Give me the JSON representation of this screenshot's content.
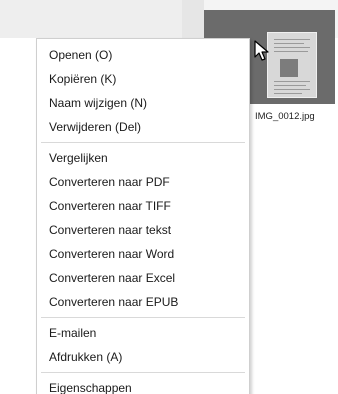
{
  "context_menu": {
    "groups": [
      [
        "Openen (O)",
        "Kopiëren (K)",
        "Naam wijzigen (N)",
        "Verwijderen (Del)"
      ],
      [
        "Vergelijken",
        "Converteren naar PDF",
        "Converteren naar TIFF",
        "Converteren naar tekst",
        "Converteren naar Word",
        "Converteren naar Excel",
        "Converteren naar EPUB"
      ],
      [
        "E-mailen",
        "Afdrukken (A)"
      ],
      [
        "Eigenschappen"
      ]
    ]
  },
  "thumbnail": {
    "filename": "IMG_0012.jpg",
    "selected": true
  },
  "icons": {
    "cursor": "mouse-pointer-icon"
  }
}
